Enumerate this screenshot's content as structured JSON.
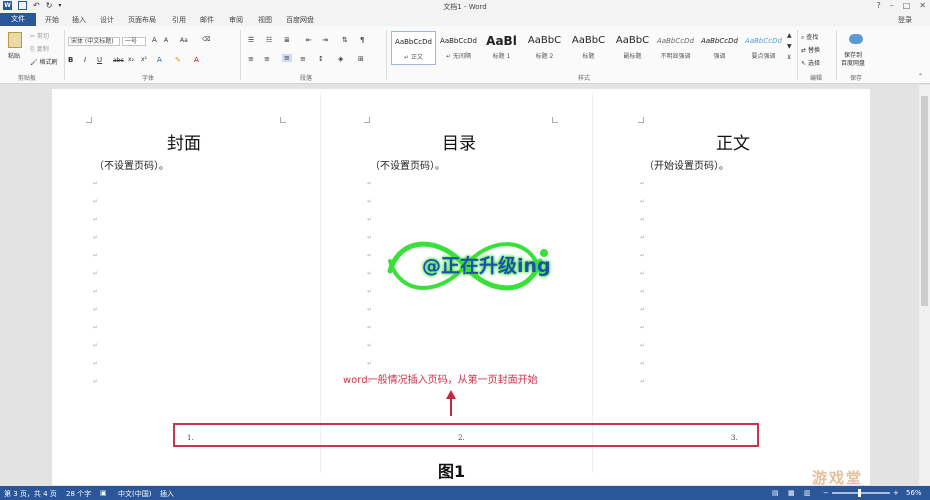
{
  "titlebar": {
    "title": "文档1 - Word",
    "help": "?",
    "min": "–",
    "max": "□",
    "close": "✕"
  },
  "tabs": [
    "文件",
    "开始",
    "插入",
    "设计",
    "页面布局",
    "引用",
    "邮件",
    "审阅",
    "视图",
    "百度网盘"
  ],
  "login": "登录",
  "ribbon": {
    "clipboard": {
      "paste": "粘贴",
      "cut": "剪切",
      "copy": "复制",
      "format_painter": "格式刷",
      "label": "剪贴板"
    },
    "font": {
      "name": "宋体 (中文标题)",
      "size": "一号",
      "grow": "A",
      "shrink": "A",
      "case": "Aa",
      "bold": "B",
      "italic": "I",
      "underline": "U",
      "strike": "abc",
      "sub": "x₂",
      "sup": "x²",
      "label": "字体"
    },
    "paragraph": {
      "label": "段落"
    },
    "styles": {
      "items": [
        {
          "sample": "AaBbCcDd",
          "name": "↵ 正文"
        },
        {
          "sample": "AaBbCcDd",
          "name": "↵ 无间隔"
        },
        {
          "sample": "AaBl",
          "name": "标题 1"
        },
        {
          "sample": "AaBbC",
          "name": "标题 2"
        },
        {
          "sample": "AaBbC",
          "name": "标题"
        },
        {
          "sample": "AaBbC",
          "name": "副标题"
        },
        {
          "sample": "AaBbCcDd",
          "name": "不明显强调"
        },
        {
          "sample": "AaBbCcDd",
          "name": "强调"
        },
        {
          "sample": "AaBbCcDd",
          "name": "要点强调"
        }
      ],
      "label": "样式"
    },
    "editing": {
      "find": "查找",
      "replace": "替换",
      "select": "选择",
      "label": "编辑"
    },
    "save": {
      "line1": "保存到",
      "line2": "百度网盘",
      "label": "保存"
    }
  },
  "document": {
    "columns": [
      {
        "title": "封面",
        "subtitle": "（不设置页码）。"
      },
      {
        "title": "目录",
        "subtitle": "（不设置页码）。"
      },
      {
        "title": "正文",
        "subtitle": "（开始设置页码）。"
      }
    ],
    "watermark": "@正在升级ing",
    "annotation": "word一般情况插入页码，从第一页封面开始",
    "page_numbers": [
      "1.",
      "2.",
      "3."
    ],
    "figure_label": "图1"
  },
  "status": {
    "page": "第 3 页，共 4 页",
    "words": "28 个字",
    "lang": "中文(中国)",
    "mode": "插入",
    "zoom": "56%",
    "zoom_level": 0.56
  },
  "overlay_logo": "游戏堂",
  "colors": {
    "accent": "#2b579a",
    "annotation": "#d0304b",
    "watermark_fill": "#1e4fb0",
    "watermark_glow": "#39e03a"
  }
}
